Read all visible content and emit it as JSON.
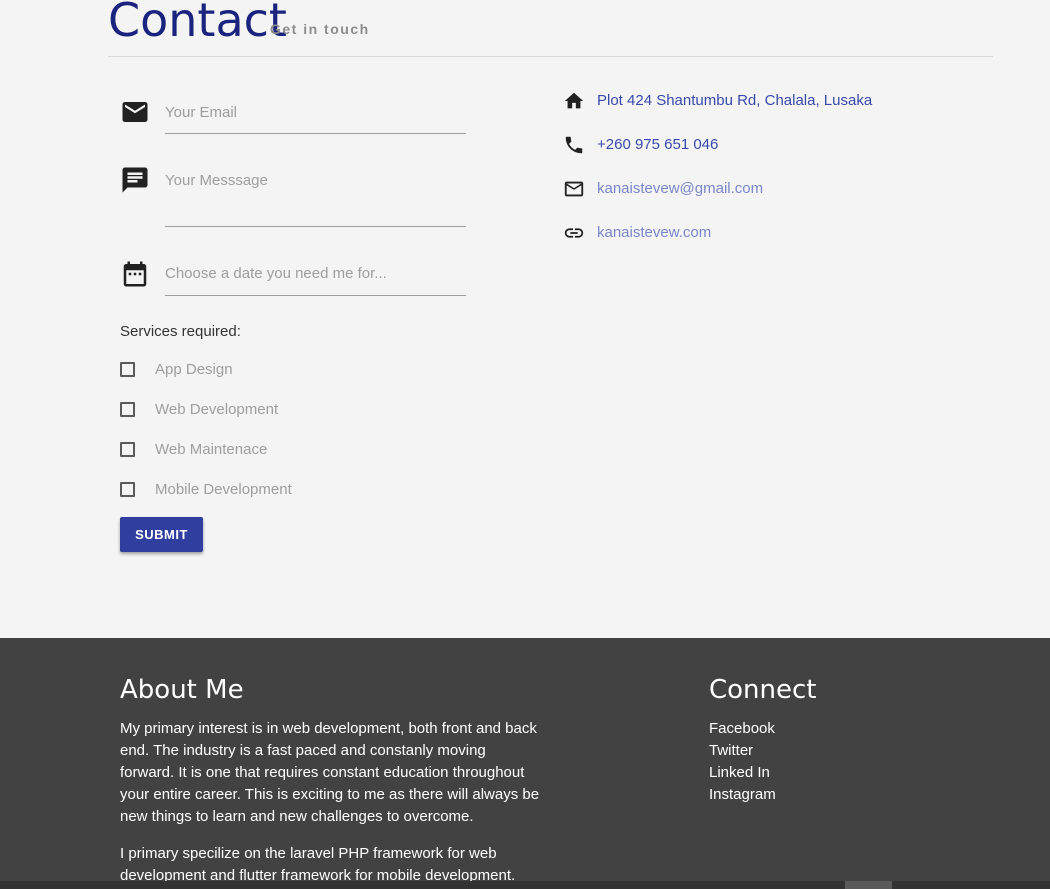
{
  "header": {
    "title": "Contact",
    "subtitle": "Get in touch"
  },
  "form": {
    "email_placeholder": "Your Email",
    "message_placeholder": "Your Messsage",
    "date_placeholder": "Choose a date you need me for...",
    "services_label": "Services required:",
    "services": [
      {
        "label": "App Design",
        "checked": false
      },
      {
        "label": "Web Development",
        "checked": false
      },
      {
        "label": "Web Maintenace",
        "checked": false
      },
      {
        "label": "Mobile Development",
        "checked": false
      }
    ],
    "submit_label": "SUBMIT"
  },
  "contact_info": {
    "address": "Plot 424 Shantumbu Rd, Chalala, Lusaka",
    "phone": "+260 975 651 046",
    "email": "kanaistevew@gmail.com",
    "website": "kanaistevew.com"
  },
  "footer": {
    "about_title": "About Me",
    "about_p1": "My primary interest is in web development, both front and back end. The industry is a fast paced and constanly moving forward. It is one that requires constant education throughout your entire career. This is exciting to me as there will always be new things to learn and new challenges to overcome.",
    "about_p2": "I primary specilize on the laravel PHP framework for web development and flutter framework for mobile development.",
    "connect_title": "Connect",
    "connect_links": [
      "Facebook",
      "Twitter",
      "Linked In",
      "Instagram"
    ]
  },
  "colors": {
    "title": "#1a237e",
    "accent": "#303f9f",
    "link_dark": "#3949ab",
    "link_light": "#7986cb",
    "footer_bg": "#424242"
  },
  "icons": [
    "email-icon",
    "message-icon",
    "calendar-icon",
    "home-icon",
    "phone-icon",
    "mail-outline-icon",
    "link-icon"
  ]
}
